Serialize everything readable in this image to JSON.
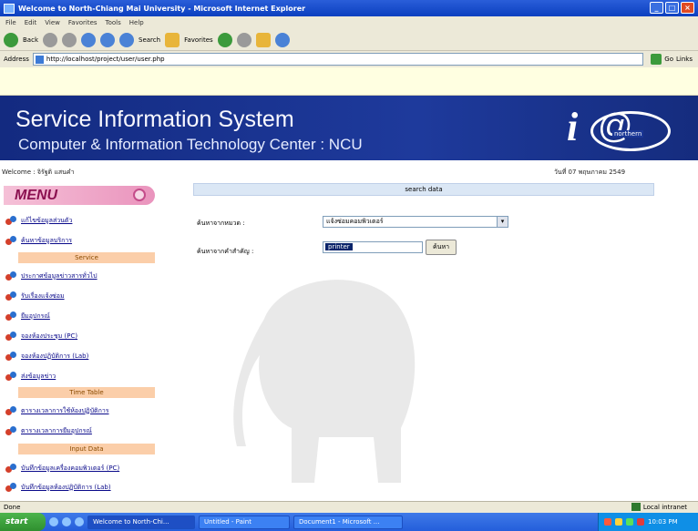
{
  "window": {
    "title": "Welcome to North-Chiang Mai University - Microsoft Internet Explorer"
  },
  "menubar": [
    "File",
    "Edit",
    "View",
    "Favorites",
    "Tools",
    "Help"
  ],
  "toolbar": {
    "back": "Back",
    "search": "Search",
    "favorites": "Favorites"
  },
  "address": {
    "label": "Address",
    "url": "http://localhost/project/user/user.php",
    "go": "Go",
    "links": "Links"
  },
  "banner": {
    "title": "Service Information System",
    "subtitle": "Computer & Information Technology Center : NCU",
    "logo_letter": "i",
    "logo_at": "@",
    "logo_text": "northern"
  },
  "welcome": "Welcome : จิรัฐติ แสนคำ",
  "date": "วันที่ 07 พฤษภาคม 2549",
  "sidebar": {
    "menu_title": "MENU",
    "items_top": [
      {
        "label": "แก้ไขข้อมูลส่วนตัว"
      },
      {
        "label": "ค้นหาข้อมูลบริการ"
      }
    ],
    "section1": "Service",
    "items_service": [
      {
        "label": "ประกาศข้อมูลข่าวสารทั่วไป"
      },
      {
        "label": "รับเรื่องแจ้งซ่อม"
      },
      {
        "label": "ยืมอุปกรณ์"
      },
      {
        "label": "จองห้องประชุม (PC)"
      },
      {
        "label": "จองห้องปฏิบัติการ (Lab)"
      },
      {
        "label": "ส่งข้อมูลข่าว"
      }
    ],
    "section2": "Time Table",
    "items_time": [
      {
        "label": "ตารางเวลาการใช้ห้องปฏิบัติการ"
      },
      {
        "label": "ตารางเวลาการยืมอุปกรณ์"
      }
    ],
    "section3": "Input Data",
    "items_input": [
      {
        "label": "บันทึกข้อมูลเครื่องคอมพิวเตอร์ (PC)"
      },
      {
        "label": "บันทึกข้อมูลห้องปฏิบัติการ (Lab)"
      }
    ]
  },
  "main": {
    "header": "search data",
    "field1_label": "ค้นหาจากหมวด :",
    "field1_value": "แจ้งซ่อมคอมพิวเตอร์",
    "field2_label": "ค้นหาจากคำสำคัญ :",
    "field2_value": "printer",
    "submit": "ค้นหา"
  },
  "status": {
    "left": "Done",
    "zone": "Local intranet"
  },
  "taskbar": {
    "start": "start",
    "tasks": [
      "Welcome to North-Chi...",
      "Untitled - Paint",
      "Document1 - Microsoft ..."
    ],
    "clock": "10:03 PM"
  }
}
